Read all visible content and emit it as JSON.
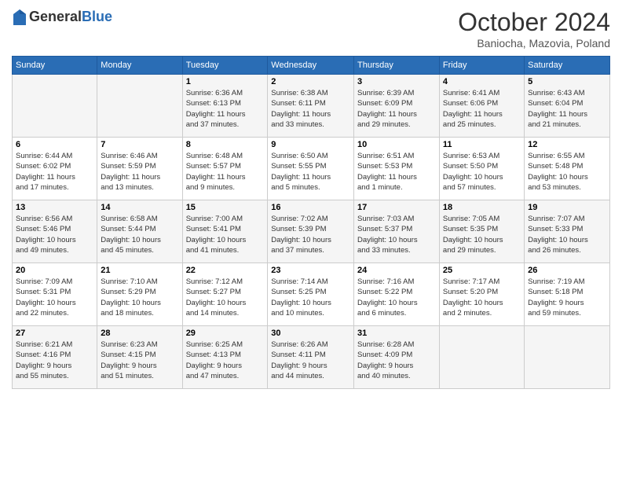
{
  "logo": {
    "general": "General",
    "blue": "Blue"
  },
  "header": {
    "month": "October 2024",
    "location": "Baniocha, Mazovia, Poland"
  },
  "weekdays": [
    "Sunday",
    "Monday",
    "Tuesday",
    "Wednesday",
    "Thursday",
    "Friday",
    "Saturday"
  ],
  "weeks": [
    [
      {
        "day": "",
        "info": ""
      },
      {
        "day": "",
        "info": ""
      },
      {
        "day": "1",
        "info": "Sunrise: 6:36 AM\nSunset: 6:13 PM\nDaylight: 11 hours\nand 37 minutes."
      },
      {
        "day": "2",
        "info": "Sunrise: 6:38 AM\nSunset: 6:11 PM\nDaylight: 11 hours\nand 33 minutes."
      },
      {
        "day": "3",
        "info": "Sunrise: 6:39 AM\nSunset: 6:09 PM\nDaylight: 11 hours\nand 29 minutes."
      },
      {
        "day": "4",
        "info": "Sunrise: 6:41 AM\nSunset: 6:06 PM\nDaylight: 11 hours\nand 25 minutes."
      },
      {
        "day": "5",
        "info": "Sunrise: 6:43 AM\nSunset: 6:04 PM\nDaylight: 11 hours\nand 21 minutes."
      }
    ],
    [
      {
        "day": "6",
        "info": "Sunrise: 6:44 AM\nSunset: 6:02 PM\nDaylight: 11 hours\nand 17 minutes."
      },
      {
        "day": "7",
        "info": "Sunrise: 6:46 AM\nSunset: 5:59 PM\nDaylight: 11 hours\nand 13 minutes."
      },
      {
        "day": "8",
        "info": "Sunrise: 6:48 AM\nSunset: 5:57 PM\nDaylight: 11 hours\nand 9 minutes."
      },
      {
        "day": "9",
        "info": "Sunrise: 6:50 AM\nSunset: 5:55 PM\nDaylight: 11 hours\nand 5 minutes."
      },
      {
        "day": "10",
        "info": "Sunrise: 6:51 AM\nSunset: 5:53 PM\nDaylight: 11 hours\nand 1 minute."
      },
      {
        "day": "11",
        "info": "Sunrise: 6:53 AM\nSunset: 5:50 PM\nDaylight: 10 hours\nand 57 minutes."
      },
      {
        "day": "12",
        "info": "Sunrise: 6:55 AM\nSunset: 5:48 PM\nDaylight: 10 hours\nand 53 minutes."
      }
    ],
    [
      {
        "day": "13",
        "info": "Sunrise: 6:56 AM\nSunset: 5:46 PM\nDaylight: 10 hours\nand 49 minutes."
      },
      {
        "day": "14",
        "info": "Sunrise: 6:58 AM\nSunset: 5:44 PM\nDaylight: 10 hours\nand 45 minutes."
      },
      {
        "day": "15",
        "info": "Sunrise: 7:00 AM\nSunset: 5:41 PM\nDaylight: 10 hours\nand 41 minutes."
      },
      {
        "day": "16",
        "info": "Sunrise: 7:02 AM\nSunset: 5:39 PM\nDaylight: 10 hours\nand 37 minutes."
      },
      {
        "day": "17",
        "info": "Sunrise: 7:03 AM\nSunset: 5:37 PM\nDaylight: 10 hours\nand 33 minutes."
      },
      {
        "day": "18",
        "info": "Sunrise: 7:05 AM\nSunset: 5:35 PM\nDaylight: 10 hours\nand 29 minutes."
      },
      {
        "day": "19",
        "info": "Sunrise: 7:07 AM\nSunset: 5:33 PM\nDaylight: 10 hours\nand 26 minutes."
      }
    ],
    [
      {
        "day": "20",
        "info": "Sunrise: 7:09 AM\nSunset: 5:31 PM\nDaylight: 10 hours\nand 22 minutes."
      },
      {
        "day": "21",
        "info": "Sunrise: 7:10 AM\nSunset: 5:29 PM\nDaylight: 10 hours\nand 18 minutes."
      },
      {
        "day": "22",
        "info": "Sunrise: 7:12 AM\nSunset: 5:27 PM\nDaylight: 10 hours\nand 14 minutes."
      },
      {
        "day": "23",
        "info": "Sunrise: 7:14 AM\nSunset: 5:25 PM\nDaylight: 10 hours\nand 10 minutes."
      },
      {
        "day": "24",
        "info": "Sunrise: 7:16 AM\nSunset: 5:22 PM\nDaylight: 10 hours\nand 6 minutes."
      },
      {
        "day": "25",
        "info": "Sunrise: 7:17 AM\nSunset: 5:20 PM\nDaylight: 10 hours\nand 2 minutes."
      },
      {
        "day": "26",
        "info": "Sunrise: 7:19 AM\nSunset: 5:18 PM\nDaylight: 9 hours\nand 59 minutes."
      }
    ],
    [
      {
        "day": "27",
        "info": "Sunrise: 6:21 AM\nSunset: 4:16 PM\nDaylight: 9 hours\nand 55 minutes."
      },
      {
        "day": "28",
        "info": "Sunrise: 6:23 AM\nSunset: 4:15 PM\nDaylight: 9 hours\nand 51 minutes."
      },
      {
        "day": "29",
        "info": "Sunrise: 6:25 AM\nSunset: 4:13 PM\nDaylight: 9 hours\nand 47 minutes."
      },
      {
        "day": "30",
        "info": "Sunrise: 6:26 AM\nSunset: 4:11 PM\nDaylight: 9 hours\nand 44 minutes."
      },
      {
        "day": "31",
        "info": "Sunrise: 6:28 AM\nSunset: 4:09 PM\nDaylight: 9 hours\nand 40 minutes."
      },
      {
        "day": "",
        "info": ""
      },
      {
        "day": "",
        "info": ""
      }
    ]
  ]
}
